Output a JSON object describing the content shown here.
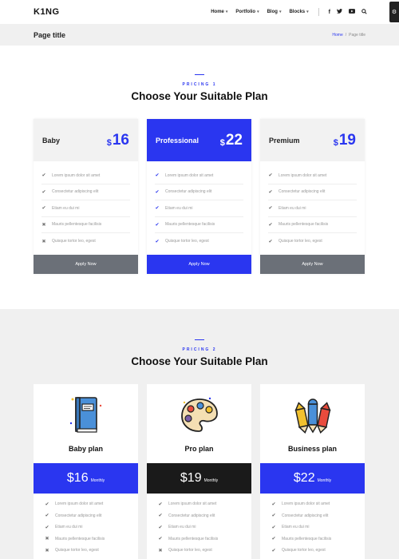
{
  "header": {
    "logo": "K1NG",
    "nav": [
      {
        "label": "Home"
      },
      {
        "label": "Portfolio"
      },
      {
        "label": "Blog"
      },
      {
        "label": "Blocks"
      }
    ],
    "social_icons": [
      "facebook-icon",
      "twitter-icon",
      "youtube-icon",
      "search-icon"
    ],
    "gear_icon": "gear-icon"
  },
  "titlebar": {
    "title": "Page title",
    "breadcrumb": {
      "home": "Home",
      "separator": "/",
      "current": "Page title"
    }
  },
  "pricing1": {
    "eyebrow": "PRICING 1",
    "title": "Choose Your Suitable Plan",
    "plans": [
      {
        "name": "Baby",
        "currency": "$",
        "price": "16",
        "button": "Apply Now"
      },
      {
        "name": "Professional",
        "currency": "$",
        "price": "22",
        "button": "Apply Now"
      },
      {
        "name": "Premium",
        "currency": "$",
        "price": "19",
        "button": "Apply Now"
      }
    ],
    "features": [
      "Lorem ipsum dolor sit amet",
      "Consectetur adipiscing elit",
      "Etiam eu dui mi",
      "Mauris pellentesque facilisis",
      "Quisque tortor leo, egest"
    ]
  },
  "pricing2": {
    "eyebrow": "PRICING 2",
    "title": "Choose Your Suitable Plan",
    "plans": [
      {
        "name": "Baby plan",
        "price": "$16",
        "period": "Monthly",
        "icon": "book-icon"
      },
      {
        "name": "Pro plan",
        "price": "$19",
        "period": "Monthly",
        "icon": "palette-icon"
      },
      {
        "name": "Business plan",
        "price": "$22",
        "period": "Monthly",
        "icon": "pencils-icon"
      }
    ],
    "features": [
      "Lorem ipsum dolor sit amet",
      "Consectetur adipiscing elit",
      "Etiam eu dui mi",
      "Mauris pellentesque facilisis",
      "Quisque tortor leo, egest"
    ]
  },
  "colors": {
    "accent": "#2a36f0",
    "button_gray": "#6b7078",
    "dark": "#1a1a1a",
    "section_bg": "#f0f0f0"
  }
}
